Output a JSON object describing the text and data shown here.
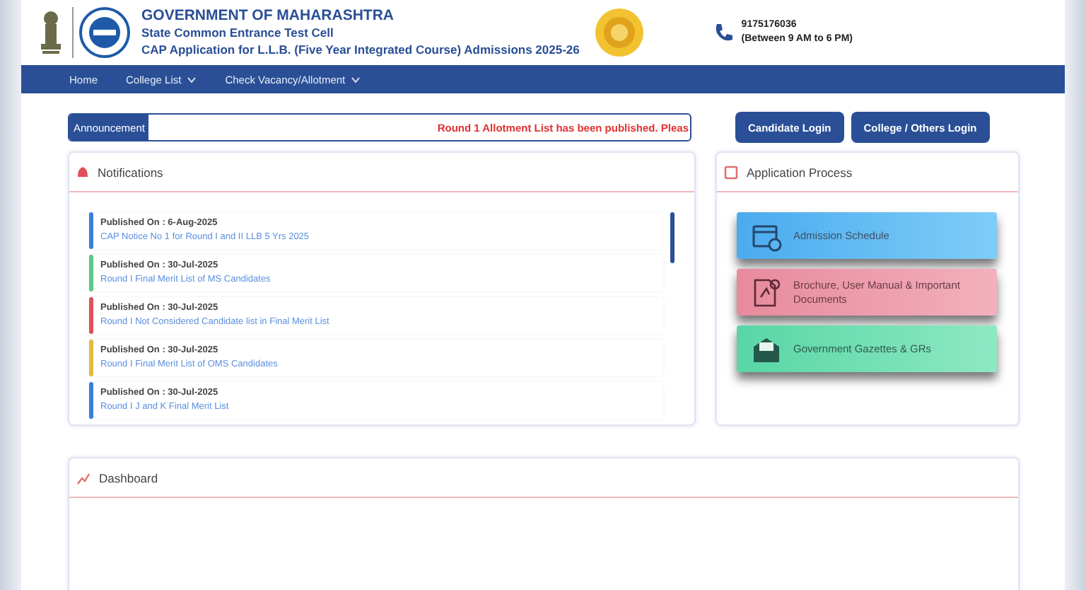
{
  "header": {
    "title": "GOVERNMENT OF MAHARASHTRA",
    "subtitle": "State Common Entrance Test Cell",
    "tagline": "CAP Application for L.L.B. (Five Year Integrated Course) Admissions 2025-26",
    "phone": "9175176036",
    "hours": "(Between 9 AM to 6 PM)"
  },
  "nav": [
    {
      "label": "Home",
      "dropdown": false
    },
    {
      "label": "College List",
      "dropdown": true
    },
    {
      "label": "Check Vacancy/Allotment",
      "dropdown": true
    }
  ],
  "announcement": {
    "label": "Announcement",
    "text": "Round 1 Allotment List has been published. Pleas"
  },
  "login_buttons": [
    "Candidate Login",
    "College / Others Login"
  ],
  "notifications": {
    "title": "Notifications",
    "items": [
      {
        "published": "Published On : 6-Aug-2025",
        "link": "CAP Notice No 1 for Round I and II LLB 5 Yrs 2025",
        "color": "#3b7ddd"
      },
      {
        "published": "Published On : 30-Jul-2025",
        "link": "Round I Final Merit List of MS Candidates",
        "color": "#5cc98a"
      },
      {
        "published": "Published On : 30-Jul-2025",
        "link": "Round I Not Considered Candidate list in Final Merit List",
        "color": "#e0505a"
      },
      {
        "published": "Published On : 30-Jul-2025",
        "link": "Round I Final Merit List of OMS Candidates",
        "color": "#e8b840"
      },
      {
        "published": "Published On : 30-Jul-2025",
        "link": "Round I J and K Final Merit List",
        "color": "#3b7ddd"
      }
    ]
  },
  "application_process": {
    "title": "Application Process",
    "cards": [
      {
        "kind": "schedule",
        "label": "Admission Schedule"
      },
      {
        "kind": "brochure",
        "label": "Brochure, User Manual & Important Documents"
      },
      {
        "kind": "gazette",
        "label": "Government Gazettes & GRs"
      }
    ]
  },
  "dashboard": {
    "title": "Dashboard"
  }
}
